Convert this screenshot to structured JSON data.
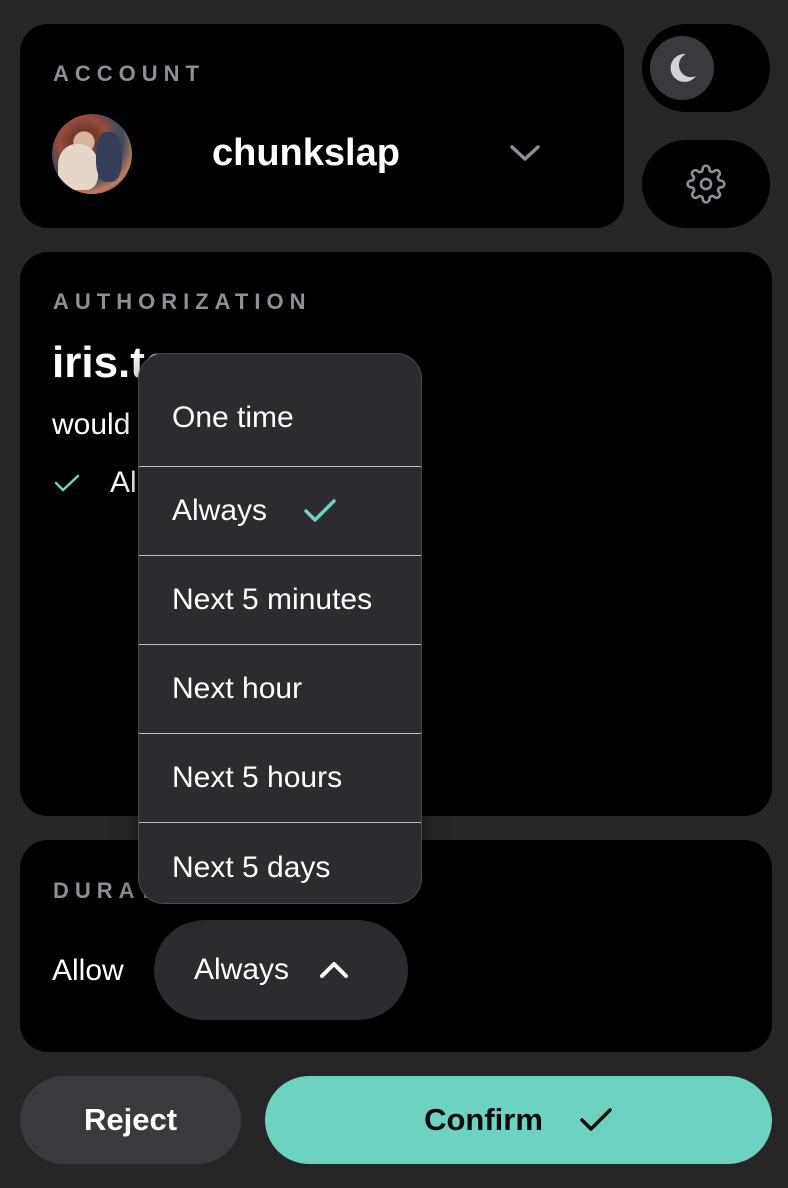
{
  "colors": {
    "background": "#262626",
    "card": "#000000",
    "accent": "#6bd3c0",
    "muted_label": "#8e8e93",
    "menu_bg": "#2c2c2e",
    "reject_bg": "#3a3a3c"
  },
  "account": {
    "section_label": "ACCOUNT",
    "username": "chunkslap",
    "avatar_icon": "user-avatar",
    "chevron_icon": "chevron-down-icon"
  },
  "side_controls": {
    "theme_toggle_icon": "moon-icon",
    "settings_icon": "gear-icon"
  },
  "authorization": {
    "section_label": "AUTHORIZATION",
    "site": "iris.to",
    "site_visible": "iris.t",
    "description": "would like to",
    "description_visible": "would",
    "permissions": [
      {
        "icon": "check-icon",
        "label_visible": "Al"
      }
    ]
  },
  "duration": {
    "section_label": "DURATION",
    "section_label_visible": "DURA",
    "allow_label": "Allow",
    "selected": "Always",
    "chevron_icon": "chevron-up-icon",
    "options": [
      {
        "label": "One time",
        "selected": false
      },
      {
        "label": "Always",
        "selected": true
      },
      {
        "label": "Next 5 minutes",
        "selected": false
      },
      {
        "label": "Next hour",
        "selected": false
      },
      {
        "label": "Next 5 hours",
        "selected": false
      },
      {
        "label": "Next 5 days",
        "selected": false
      }
    ]
  },
  "actions": {
    "reject_label": "Reject",
    "confirm_label": "Confirm",
    "confirm_icon": "check-icon"
  }
}
